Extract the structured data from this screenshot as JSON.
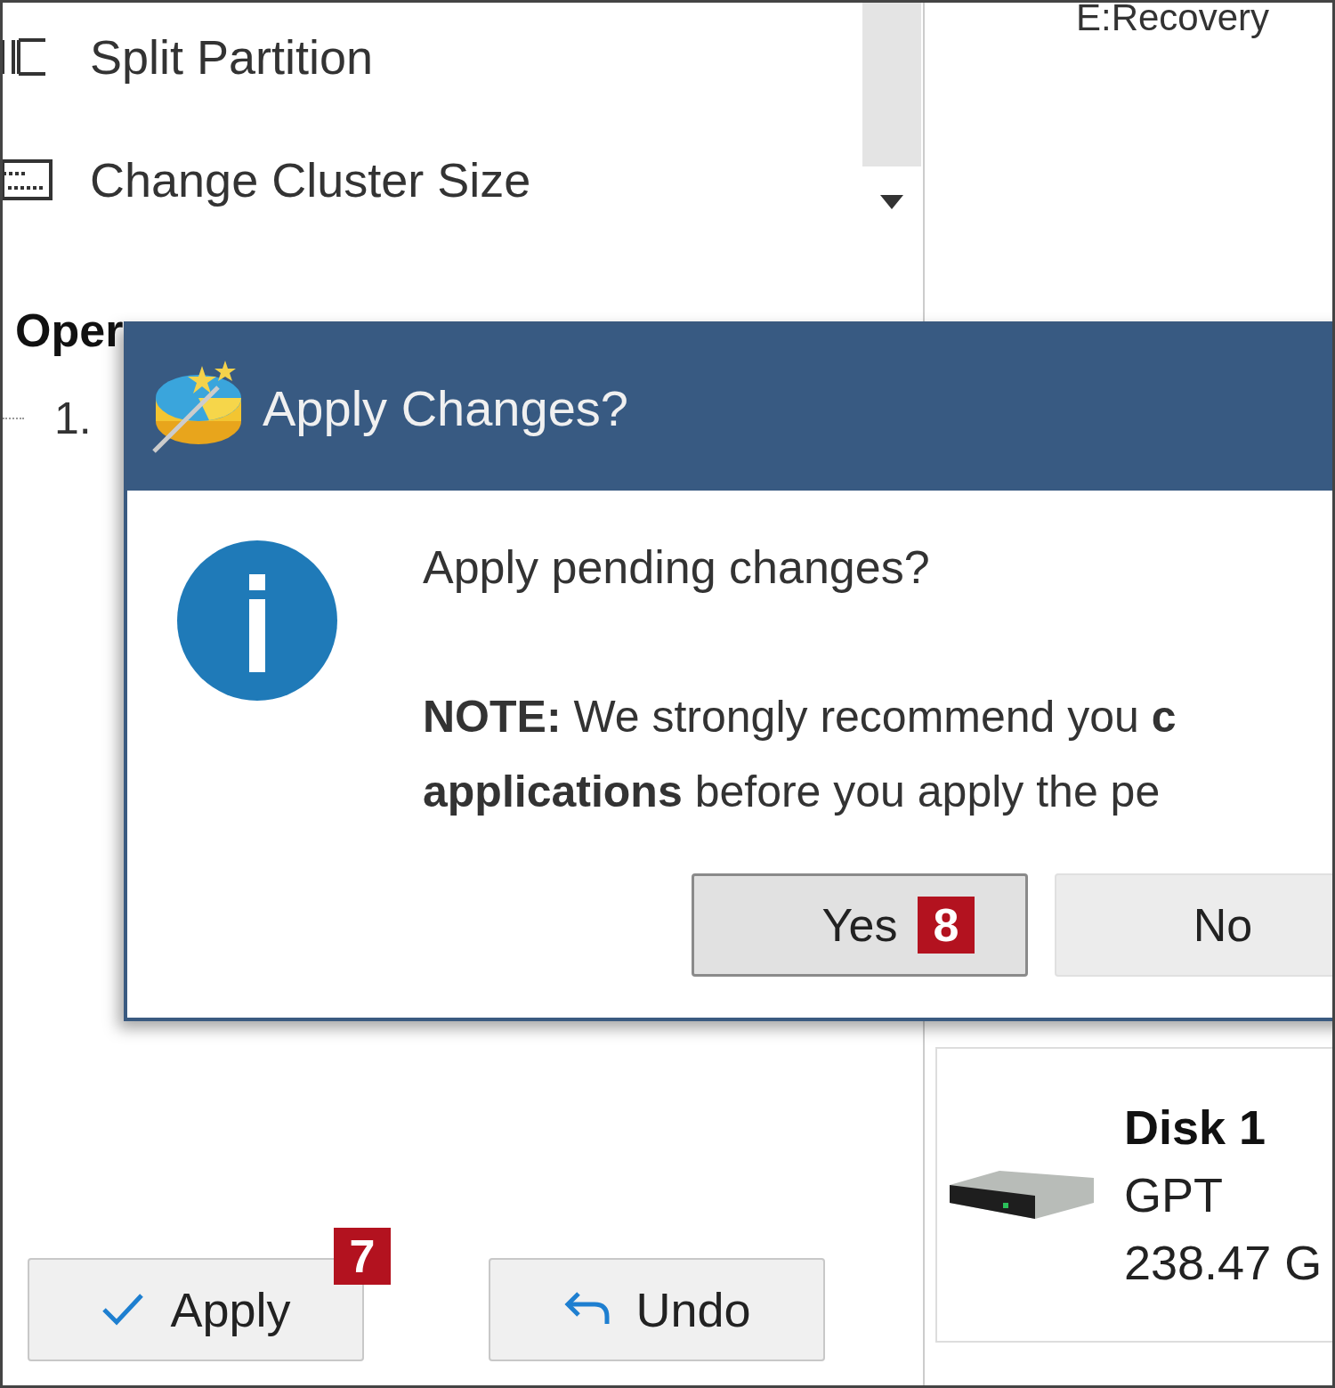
{
  "left_panel": {
    "menu_items": [
      {
        "label": "Split Partition",
        "kind": "split"
      },
      {
        "label": "Change Cluster Size",
        "kind": "cluster"
      }
    ],
    "section_title": "Oper",
    "operations": [
      "1."
    ],
    "buttons": [
      {
        "label": "Apply",
        "kind": "apply",
        "badge": "7"
      },
      {
        "label": "Undo",
        "kind": "undo"
      }
    ]
  },
  "right_panel": {
    "partition_label": "E:Recovery",
    "disk": {
      "name": "Disk 1",
      "type": "GPT",
      "size": "238.47 G"
    }
  },
  "dialog": {
    "title": "Apply Changes?",
    "message": "Apply pending changes?",
    "note_lines": [
      "**NOTE:** We strongly recommend you **c**",
      "**applications** before you apply the pe"
    ],
    "buttons": [
      {
        "label": "Yes",
        "focused": true,
        "badge": "8"
      },
      {
        "label": "No",
        "focused": false
      }
    ]
  }
}
